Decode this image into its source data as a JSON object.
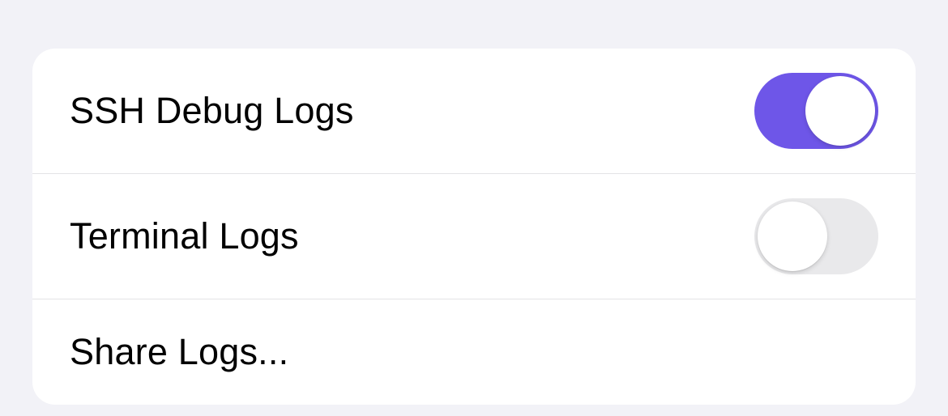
{
  "settings": {
    "rows": [
      {
        "label": "SSH Debug Logs",
        "toggle": true
      },
      {
        "label": "Terminal Logs",
        "toggle": false
      },
      {
        "label": "Share Logs..."
      }
    ]
  },
  "colors": {
    "accent": "#6e56e8",
    "background": "#f2f2f7",
    "card": "#ffffff",
    "divider": "#e3e3e6",
    "toggleOff": "#e9e9eb"
  }
}
